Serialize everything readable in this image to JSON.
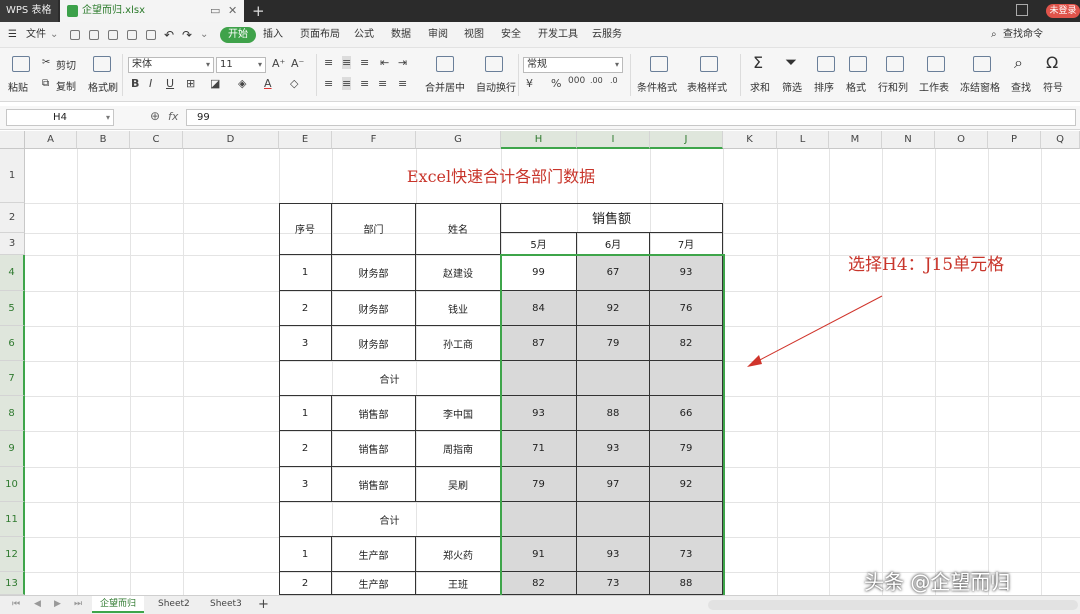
{
  "titlebar": {
    "app": "WPS 表格",
    "doc_tab": "企望而归.xlsx",
    "login": "未登录"
  },
  "menubar": {
    "file": "文件",
    "tabs": [
      "开始",
      "插入",
      "页面布局",
      "公式",
      "数据",
      "审阅",
      "视图",
      "安全",
      "开发工具",
      "云服务"
    ],
    "search": "查找命令"
  },
  "ribbon": {
    "paste": "粘贴",
    "cut": "剪切",
    "copy": "复制",
    "format_painter": "格式刷",
    "font_name": "宋体",
    "font_size": "11",
    "merge_center": "合并居中",
    "wrap_text": "自动换行",
    "number_format": "常规",
    "conditional_format": "条件格式",
    "table_style": "表格样式",
    "sum": "求和",
    "filter": "筛选",
    "sort": "排序",
    "format": "格式",
    "row_col": "行和列",
    "worksheet": "工作表",
    "freeze": "冻结窗格",
    "find": "查找",
    "symbol": "符号"
  },
  "formula_bar": {
    "name_box": "H4",
    "fx": "fx",
    "value": "99"
  },
  "columns": [
    "A",
    "B",
    "C",
    "D",
    "E",
    "F",
    "G",
    "H",
    "I",
    "J",
    "K",
    "L",
    "M",
    "N",
    "O",
    "P",
    "Q"
  ],
  "rows": [
    "1",
    "2",
    "3",
    "4",
    "5",
    "6",
    "7",
    "8",
    "9",
    "10",
    "11",
    "12",
    "13"
  ],
  "table": {
    "title": "Excel快速合计各部门数据",
    "headers": {
      "no": "序号",
      "dept": "部门",
      "name": "姓名",
      "sales": "销售额",
      "may": "5月",
      "jun": "6月",
      "jul": "7月"
    },
    "data_rows": [
      {
        "no": "1",
        "dept": "财务部",
        "name": "赵建设",
        "may": "99",
        "jun": "67",
        "jul": "93"
      },
      {
        "no": "2",
        "dept": "财务部",
        "name": "钱业",
        "may": "84",
        "jun": "92",
        "jul": "76"
      },
      {
        "no": "3",
        "dept": "财务部",
        "name": "孙工商",
        "may": "87",
        "jun": "79",
        "jul": "82"
      },
      {
        "total": "合计"
      },
      {
        "no": "1",
        "dept": "销售部",
        "name": "李中国",
        "may": "93",
        "jun": "88",
        "jul": "66"
      },
      {
        "no": "2",
        "dept": "销售部",
        "name": "周指南",
        "may": "71",
        "jun": "93",
        "jul": "79"
      },
      {
        "no": "3",
        "dept": "销售部",
        "name": "吴刷",
        "may": "79",
        "jun": "97",
        "jul": "92"
      },
      {
        "total": "合计"
      },
      {
        "no": "1",
        "dept": "生产部",
        "name": "郑火药",
        "may": "91",
        "jun": "93",
        "jul": "73"
      },
      {
        "no": "2",
        "dept": "生产部",
        "name": "王班",
        "may": "82",
        "jun": "73",
        "jul": "88"
      }
    ]
  },
  "annotation": "选择H4：J15单元格",
  "sheet_tabs": [
    "企望而归",
    "Sheet2",
    "Sheet3"
  ],
  "watermark": "头条 @企望而归",
  "colors": {
    "accent_green": "#3ea54a",
    "title_red": "#c8352b",
    "selection_gray": "#d9d9d9"
  }
}
